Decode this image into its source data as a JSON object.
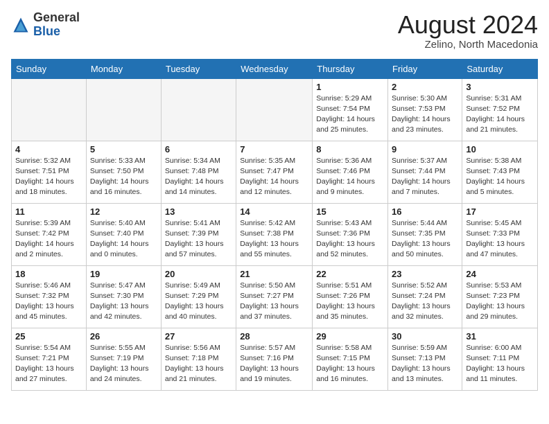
{
  "header": {
    "logo_general": "General",
    "logo_blue": "Blue",
    "main_title": "August 2024",
    "subtitle": "Zelino, North Macedonia"
  },
  "weekdays": [
    "Sunday",
    "Monday",
    "Tuesday",
    "Wednesday",
    "Thursday",
    "Friday",
    "Saturday"
  ],
  "weeks": [
    [
      {
        "day": "",
        "info": ""
      },
      {
        "day": "",
        "info": ""
      },
      {
        "day": "",
        "info": ""
      },
      {
        "day": "",
        "info": ""
      },
      {
        "day": "1",
        "info": "Sunrise: 5:29 AM\nSunset: 7:54 PM\nDaylight: 14 hours\nand 25 minutes."
      },
      {
        "day": "2",
        "info": "Sunrise: 5:30 AM\nSunset: 7:53 PM\nDaylight: 14 hours\nand 23 minutes."
      },
      {
        "day": "3",
        "info": "Sunrise: 5:31 AM\nSunset: 7:52 PM\nDaylight: 14 hours\nand 21 minutes."
      }
    ],
    [
      {
        "day": "4",
        "info": "Sunrise: 5:32 AM\nSunset: 7:51 PM\nDaylight: 14 hours\nand 18 minutes."
      },
      {
        "day": "5",
        "info": "Sunrise: 5:33 AM\nSunset: 7:50 PM\nDaylight: 14 hours\nand 16 minutes."
      },
      {
        "day": "6",
        "info": "Sunrise: 5:34 AM\nSunset: 7:48 PM\nDaylight: 14 hours\nand 14 minutes."
      },
      {
        "day": "7",
        "info": "Sunrise: 5:35 AM\nSunset: 7:47 PM\nDaylight: 14 hours\nand 12 minutes."
      },
      {
        "day": "8",
        "info": "Sunrise: 5:36 AM\nSunset: 7:46 PM\nDaylight: 14 hours\nand 9 minutes."
      },
      {
        "day": "9",
        "info": "Sunrise: 5:37 AM\nSunset: 7:44 PM\nDaylight: 14 hours\nand 7 minutes."
      },
      {
        "day": "10",
        "info": "Sunrise: 5:38 AM\nSunset: 7:43 PM\nDaylight: 14 hours\nand 5 minutes."
      }
    ],
    [
      {
        "day": "11",
        "info": "Sunrise: 5:39 AM\nSunset: 7:42 PM\nDaylight: 14 hours\nand 2 minutes."
      },
      {
        "day": "12",
        "info": "Sunrise: 5:40 AM\nSunset: 7:40 PM\nDaylight: 14 hours\nand 0 minutes."
      },
      {
        "day": "13",
        "info": "Sunrise: 5:41 AM\nSunset: 7:39 PM\nDaylight: 13 hours\nand 57 minutes."
      },
      {
        "day": "14",
        "info": "Sunrise: 5:42 AM\nSunset: 7:38 PM\nDaylight: 13 hours\nand 55 minutes."
      },
      {
        "day": "15",
        "info": "Sunrise: 5:43 AM\nSunset: 7:36 PM\nDaylight: 13 hours\nand 52 minutes."
      },
      {
        "day": "16",
        "info": "Sunrise: 5:44 AM\nSunset: 7:35 PM\nDaylight: 13 hours\nand 50 minutes."
      },
      {
        "day": "17",
        "info": "Sunrise: 5:45 AM\nSunset: 7:33 PM\nDaylight: 13 hours\nand 47 minutes."
      }
    ],
    [
      {
        "day": "18",
        "info": "Sunrise: 5:46 AM\nSunset: 7:32 PM\nDaylight: 13 hours\nand 45 minutes."
      },
      {
        "day": "19",
        "info": "Sunrise: 5:47 AM\nSunset: 7:30 PM\nDaylight: 13 hours\nand 42 minutes."
      },
      {
        "day": "20",
        "info": "Sunrise: 5:49 AM\nSunset: 7:29 PM\nDaylight: 13 hours\nand 40 minutes."
      },
      {
        "day": "21",
        "info": "Sunrise: 5:50 AM\nSunset: 7:27 PM\nDaylight: 13 hours\nand 37 minutes."
      },
      {
        "day": "22",
        "info": "Sunrise: 5:51 AM\nSunset: 7:26 PM\nDaylight: 13 hours\nand 35 minutes."
      },
      {
        "day": "23",
        "info": "Sunrise: 5:52 AM\nSunset: 7:24 PM\nDaylight: 13 hours\nand 32 minutes."
      },
      {
        "day": "24",
        "info": "Sunrise: 5:53 AM\nSunset: 7:23 PM\nDaylight: 13 hours\nand 29 minutes."
      }
    ],
    [
      {
        "day": "25",
        "info": "Sunrise: 5:54 AM\nSunset: 7:21 PM\nDaylight: 13 hours\nand 27 minutes."
      },
      {
        "day": "26",
        "info": "Sunrise: 5:55 AM\nSunset: 7:19 PM\nDaylight: 13 hours\nand 24 minutes."
      },
      {
        "day": "27",
        "info": "Sunrise: 5:56 AM\nSunset: 7:18 PM\nDaylight: 13 hours\nand 21 minutes."
      },
      {
        "day": "28",
        "info": "Sunrise: 5:57 AM\nSunset: 7:16 PM\nDaylight: 13 hours\nand 19 minutes."
      },
      {
        "day": "29",
        "info": "Sunrise: 5:58 AM\nSunset: 7:15 PM\nDaylight: 13 hours\nand 16 minutes."
      },
      {
        "day": "30",
        "info": "Sunrise: 5:59 AM\nSunset: 7:13 PM\nDaylight: 13 hours\nand 13 minutes."
      },
      {
        "day": "31",
        "info": "Sunrise: 6:00 AM\nSunset: 7:11 PM\nDaylight: 13 hours\nand 11 minutes."
      }
    ]
  ]
}
